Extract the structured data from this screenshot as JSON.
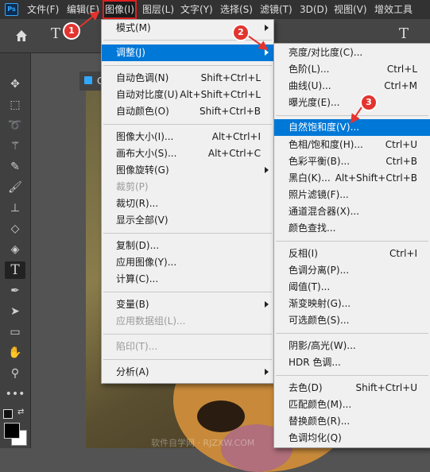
{
  "app": {
    "logo": "Ps"
  },
  "menubar": {
    "items": [
      "文件(F)",
      "编辑(E)",
      "图像(I)",
      "图层(L)",
      "文字(Y)",
      "选择(S)",
      "滤镜(T)",
      "3D(D)",
      "视图(V)",
      "增效工具"
    ]
  },
  "options_bar": {
    "type_tool": "T",
    "type_tool_right": "T"
  },
  "document": {
    "tab_label": "C"
  },
  "toolbar": {
    "icons": [
      "move-tool-icon",
      "marquee-tool-icon",
      "lasso-tool-icon",
      "magic-wand-tool-icon",
      "eyedropper-tool-icon",
      "brush-tool-icon",
      "stamp-tool-icon",
      "eraser-tool-icon",
      "paint-bucket-tool-icon",
      "type-tool-icon",
      "pen-tool-icon",
      "path-select-tool-icon",
      "rectangle-tool-icon",
      "hand-tool-icon",
      "zoom-tool-icon",
      "more-tools-icon"
    ],
    "type_tool_label": "T"
  },
  "image_menu": {
    "items": [
      {
        "label": "模式(M)"
      },
      {
        "label": "调整(J)"
      },
      {
        "label": "自动色调(N)",
        "shortcut": "Shift+Ctrl+L"
      },
      {
        "label": "自动对比度(U)",
        "shortcut": "Alt+Shift+Ctrl+L"
      },
      {
        "label": "自动颜色(O)",
        "shortcut": "Shift+Ctrl+B"
      },
      {
        "label": "图像大小(I)...",
        "shortcut": "Alt+Ctrl+I"
      },
      {
        "label": "画布大小(S)...",
        "shortcut": "Alt+Ctrl+C"
      },
      {
        "label": "图像旋转(G)"
      },
      {
        "label": "裁剪(P)"
      },
      {
        "label": "裁切(R)..."
      },
      {
        "label": "显示全部(V)"
      },
      {
        "label": "复制(D)..."
      },
      {
        "label": "应用图像(Y)..."
      },
      {
        "label": "计算(C)..."
      },
      {
        "label": "变量(B)"
      },
      {
        "label": "应用数据组(L)..."
      },
      {
        "label": "陷印(T)..."
      },
      {
        "label": "分析(A)"
      }
    ]
  },
  "adjust_menu": {
    "items": [
      {
        "label": "亮度/对比度(C)..."
      },
      {
        "label": "色阶(L)...",
        "shortcut": "Ctrl+L"
      },
      {
        "label": "曲线(U)...",
        "shortcut": "Ctrl+M"
      },
      {
        "label": "曝光度(E)..."
      },
      {
        "label": "自然饱和度(V)..."
      },
      {
        "label": "色相/饱和度(H)...",
        "shortcut": "Ctrl+U"
      },
      {
        "label": "色彩平衡(B)...",
        "shortcut": "Ctrl+B"
      },
      {
        "label": "黑白(K)...",
        "shortcut": "Alt+Shift+Ctrl+B"
      },
      {
        "label": "照片滤镜(F)..."
      },
      {
        "label": "通道混合器(X)..."
      },
      {
        "label": "颜色查找..."
      },
      {
        "label": "反相(I)",
        "shortcut": "Ctrl+I"
      },
      {
        "label": "色调分离(P)..."
      },
      {
        "label": "阈值(T)..."
      },
      {
        "label": "渐变映射(G)..."
      },
      {
        "label": "可选颜色(S)..."
      },
      {
        "label": "阴影/高光(W)..."
      },
      {
        "label": "HDR 色调..."
      },
      {
        "label": "去色(D)",
        "shortcut": "Shift+Ctrl+U"
      },
      {
        "label": "匹配颜色(M)..."
      },
      {
        "label": "替换颜色(R)..."
      },
      {
        "label": "色调均化(Q)"
      }
    ]
  },
  "annotations": [
    "1",
    "2",
    "3"
  ],
  "watermark": "软件自学网 · RJZXW.COM",
  "colors": {
    "highlight": "#0078d7",
    "annotation": "#e3342f"
  }
}
